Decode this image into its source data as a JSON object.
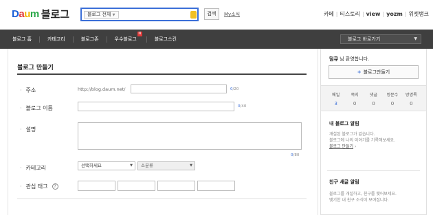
{
  "header": {
    "logo": {
      "letters": [
        {
          "char": "D",
          "color": "#1a5fd8"
        },
        {
          "char": "a",
          "color": "#e03a3a"
        },
        {
          "char": "u",
          "color": "#f2b705"
        },
        {
          "char": "m",
          "color": "#2aa84a"
        }
      ],
      "blog_text": "블로그"
    },
    "search": {
      "scope_label": "블로그 전체",
      "query": "",
      "button_label": "검색"
    },
    "my_news": "My소식",
    "top_links": [
      "카페",
      "티스토리",
      "view",
      "yozm",
      "위젯뱅크"
    ]
  },
  "nav": {
    "items": [
      "블로그 홈",
      "카테고리",
      "블로그존",
      "우수블로그",
      "블로그스킨"
    ],
    "new_badge": "N",
    "shortcut_label": "블로그 바로가기"
  },
  "form": {
    "title": "블로그 만들기",
    "address": {
      "label": "주소",
      "prefix": "http://blog.daum.net/",
      "value": "",
      "counter_current": "0",
      "counter_max": "/20"
    },
    "blog_name": {
      "label": "블로그 이름",
      "value": "",
      "counter_current": "0",
      "counter_max": "/40"
    },
    "description": {
      "label": "설명",
      "value": "",
      "counter_current": "0",
      "counter_max": "/80"
    },
    "category": {
      "label": "카테고리",
      "primary": "선택하세요",
      "secondary": "소분류"
    },
    "tags": {
      "label": "관심 태그",
      "help": "?",
      "values": [
        "",
        "",
        "",
        ""
      ]
    }
  },
  "sidebar": {
    "greeting_user": "덤큐",
    "greeting_text": " 님 환영합니다.",
    "make_blog_label": "블로그만들기",
    "stats": [
      {
        "label": "메일",
        "value": "3",
        "highlight": true
      },
      {
        "label": "쪽지",
        "value": "0",
        "highlight": false
      },
      {
        "label": "댓글",
        "value": "0",
        "highlight": false
      },
      {
        "label": "방문수",
        "value": "0",
        "highlight": false
      },
      {
        "label": "방명록",
        "value": "0",
        "highlight": false
      }
    ],
    "my_blog_alert": {
      "title": "내 블로그 알림",
      "line1": "개설된 블로그가 없습니다.",
      "line2": "블로그에 나의 이야기를 기록해보세요.",
      "link": "블로그 만들기"
    },
    "friend_posts": {
      "title": "친구 새글 알림",
      "line1": "블로그를 개설하고, 친구를 맺어보세요.",
      "line2": "맺기한 내 친구 소식이 보여집니다."
    }
  }
}
